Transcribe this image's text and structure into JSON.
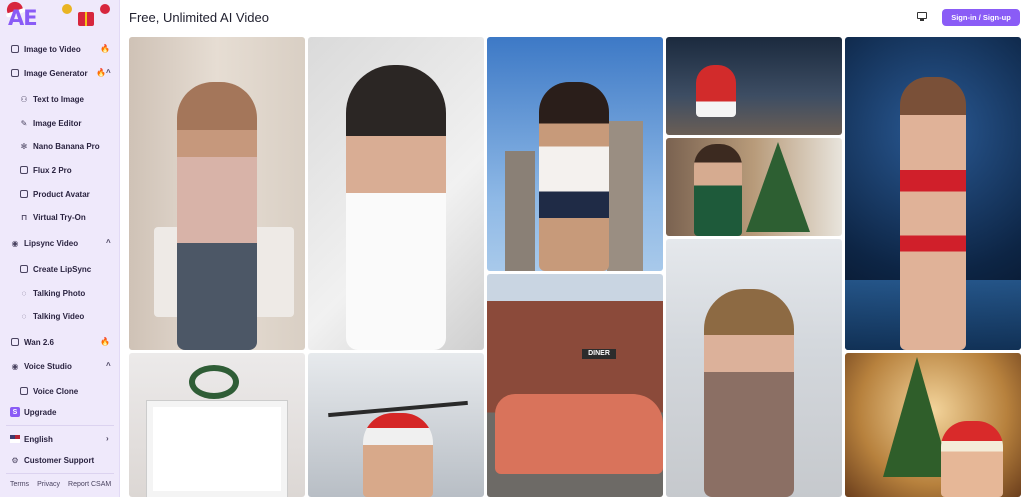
{
  "brand": {
    "logo_text": "AE"
  },
  "header": {
    "title": "Free, Unlimited AI Video",
    "signin_label": "Sign-in / Sign-up"
  },
  "sidebar": {
    "items": [
      {
        "label": "Image to Video",
        "icon": "image-video-icon",
        "hot": true
      },
      {
        "label": "Image Generator",
        "icon": "image-generator-icon",
        "hot": true,
        "expanded": true
      },
      {
        "label": "Text to Image",
        "icon": "person-icon",
        "sub": true
      },
      {
        "label": "Image Editor",
        "icon": "edit-icon",
        "sub": true
      },
      {
        "label": "Nano Banana Pro",
        "icon": "sparkle-icon",
        "sub": true
      },
      {
        "label": "Flux 2 Pro",
        "icon": "document-icon",
        "sub": true
      },
      {
        "label": "Product Avatar",
        "icon": "product-icon",
        "sub": true
      },
      {
        "label": "Virtual Try-On",
        "icon": "shirt-icon",
        "sub": true
      },
      {
        "label": "Lipsync Video",
        "icon": "lipsync-icon",
        "expanded": true
      },
      {
        "label": "Create LipSync",
        "icon": "create-icon",
        "sub": true
      },
      {
        "label": "Talking Photo",
        "icon": "talking-photo-icon",
        "sub": true
      },
      {
        "label": "Talking Video",
        "icon": "talking-video-icon",
        "sub": true
      },
      {
        "label": "Wan 2.6",
        "icon": "wan-icon",
        "hot": true
      },
      {
        "label": "Voice Studio",
        "icon": "voice-icon",
        "expanded": true
      },
      {
        "label": "Voice Clone",
        "icon": "voice-clone-icon",
        "sub": true
      },
      {
        "label": "Upgrade",
        "icon": "upgrade-icon"
      },
      {
        "label": "English",
        "icon": "flag-us-icon"
      },
      {
        "label": "Customer Support",
        "icon": "support-icon"
      }
    ],
    "footer_links": [
      "Terms",
      "Privacy",
      "Report CSAM"
    ]
  },
  "colors": {
    "accent": "#8a5cf6",
    "sidebar_bg": "#efe9fb",
    "hot": "#ff6a00"
  },
  "gallery": [
    {
      "name": "gallery-item-mirror-selfie"
    },
    {
      "name": "gallery-item-white-dress"
    },
    {
      "name": "gallery-item-city-rooftop"
    },
    {
      "name": "gallery-item-vintage-car"
    },
    {
      "name": "gallery-item-santa-city"
    },
    {
      "name": "gallery-item-christmas-tree-woman"
    },
    {
      "name": "gallery-item-office-woman"
    },
    {
      "name": "gallery-item-santa-runway"
    },
    {
      "name": "gallery-item-wreath-frame"
    },
    {
      "name": "gallery-item-santa-gym"
    },
    {
      "name": "gallery-item-christmas-hat-woman"
    }
  ]
}
